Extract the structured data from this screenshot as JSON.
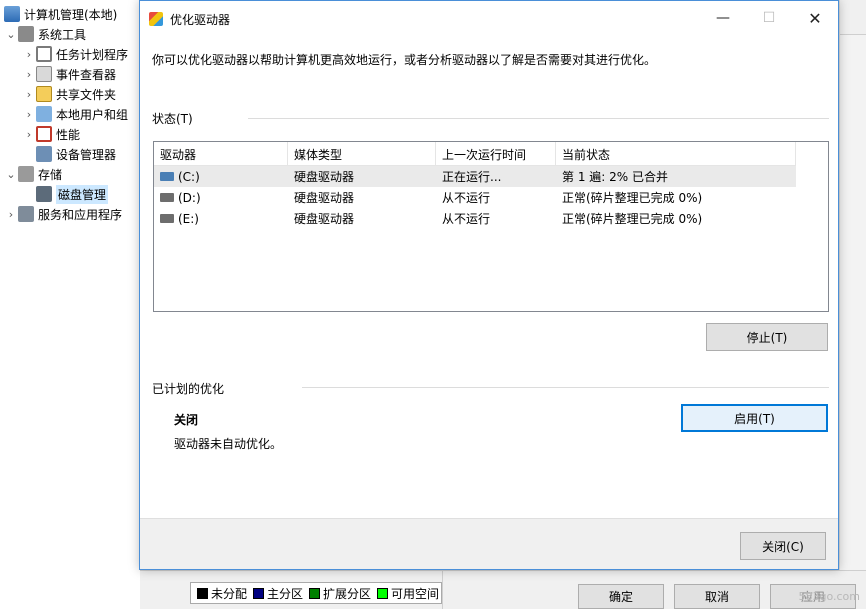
{
  "tree": {
    "root": "计算机管理(本地)",
    "system_tools": "系统工具",
    "task_scheduler": "任务计划程序",
    "event_viewer": "事件查看器",
    "shared_folders": "共享文件夹",
    "local_users": "本地用户和组",
    "performance": "性能",
    "device_manager": "设备管理器",
    "storage": "存储",
    "disk_management": "磁盘管理",
    "services": "服务和应用程序"
  },
  "legend": {
    "items": [
      {
        "label": "未分配",
        "color": "#000000"
      },
      {
        "label": "主分区",
        "color": "#000080"
      },
      {
        "label": "扩展分区",
        "color": "#008000"
      },
      {
        "label": "可用空间",
        "color": "#00ff00"
      }
    ]
  },
  "bg_buttons": {
    "ok": "确定",
    "cancel": "取消",
    "apply": "应用"
  },
  "watermark": "583go.com",
  "dialog": {
    "title": "优化驱动器",
    "intro": "你可以优化驱动器以帮助计算机更高效地运行，或者分析驱动器以了解是否需要对其进行优化。",
    "status_label": "状态(T)",
    "columns": [
      "驱动器",
      "媒体类型",
      "上一次运行时间",
      "当前状态"
    ],
    "drives": [
      {
        "name": "(C:)",
        "media": "硬盘驱动器",
        "last_run": "正在运行...",
        "status": "第 1 遍: 2% 已合并"
      },
      {
        "name": "(D:)",
        "media": "硬盘驱动器",
        "last_run": "从不运行",
        "status": "正常(碎片整理已完成 0%)"
      },
      {
        "name": "(E:)",
        "media": "硬盘驱动器",
        "last_run": "从不运行",
        "status": "正常(碎片整理已完成 0%)"
      }
    ],
    "stop_button": "停止(T)",
    "scheduled_label": "已计划的优化",
    "scheduled_status": "关闭",
    "scheduled_desc": "驱动器未自动优化。",
    "enable_button": "启用(T)",
    "close_button": "关闭(C)"
  }
}
